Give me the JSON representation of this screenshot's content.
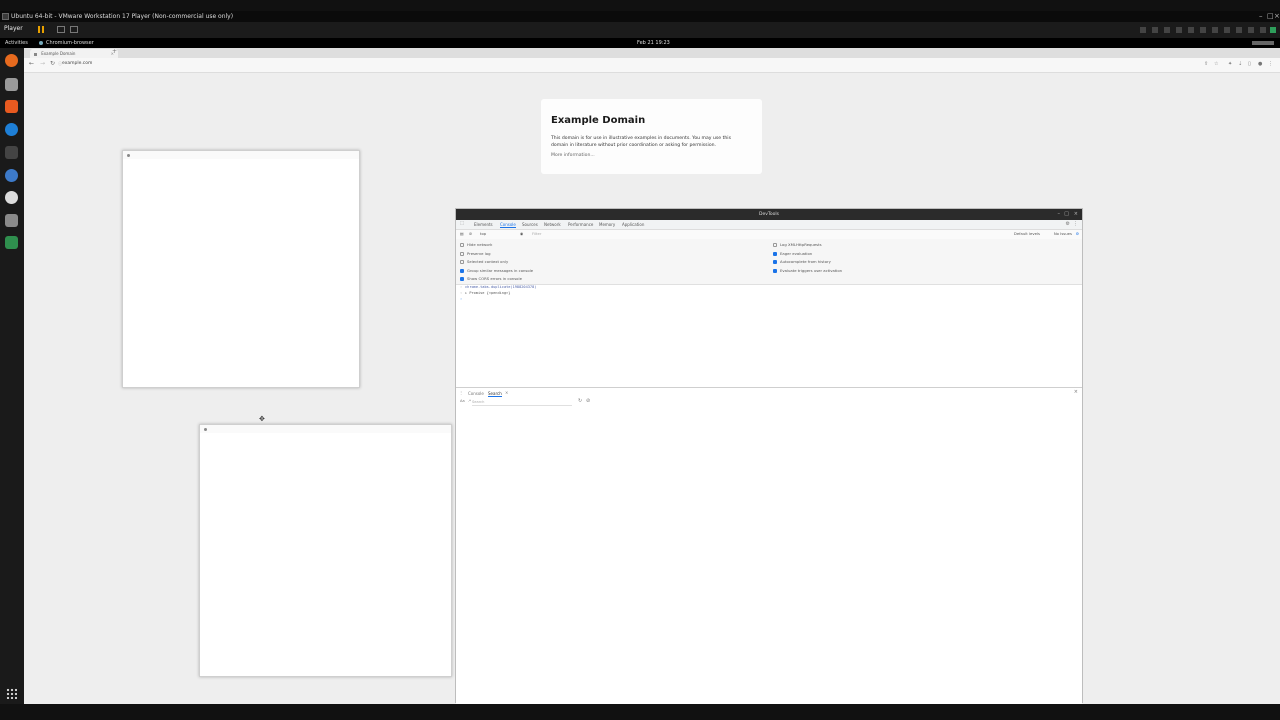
{
  "vmware": {
    "title": "Ubuntu 64-bit - VMware Workstation 17 Player (Non-commercial use only)",
    "player_label": "Player"
  },
  "ubuntu_topbar": {
    "activities": "Activities",
    "app_name": "Chromium-browser",
    "clock": "Feb 21  19:23"
  },
  "dock": {
    "icons": [
      "firefox-icon",
      "files-icon",
      "software-icon",
      "help-icon",
      "terminal-icon",
      "chromium-icon",
      "updater-icon",
      "disk-icon",
      "trash-icon",
      "apps-grid-icon"
    ]
  },
  "browser": {
    "tab_title": "Example Domain",
    "url": "example.com"
  },
  "page": {
    "heading": "Example Domain",
    "body": "This domain is for use in illustrative examples in documents. You may use this domain in literature without prior coordination or asking for permission.",
    "link": "More information..."
  },
  "devtools": {
    "title": "DevTools",
    "tabs": [
      "Elements",
      "Console",
      "Sources",
      "Network",
      "Performance",
      "Memory",
      "Application"
    ],
    "active_tab": "Console",
    "context": "top",
    "filter_placeholder": "Filter",
    "levels": "Default levels",
    "issues": "No Issues",
    "options_left": [
      "Hide network",
      "Preserve log",
      "Selected context only",
      "Group similar messages in console",
      "Show CORS errors in console"
    ],
    "options_left_checked": [
      false,
      false,
      false,
      true,
      true
    ],
    "options_right": [
      "Log XMLHttpRequests",
      "Eager evaluation",
      "Autocomplete from history",
      "Evaluate triggers user activation"
    ],
    "options_right_checked": [
      false,
      true,
      true,
      true
    ],
    "console_input": "chrome.tabs.duplicate(1988204378)",
    "console_output": "▸ Promise {<pending>}",
    "drawer_tabs": [
      "Console",
      "Search"
    ],
    "drawer_active": "Search",
    "search_placeholder": "Search"
  },
  "colors": {
    "accent": "#1a73e8",
    "desktop_bg": "#eeeeee",
    "vm_pause": "#e8a000"
  }
}
